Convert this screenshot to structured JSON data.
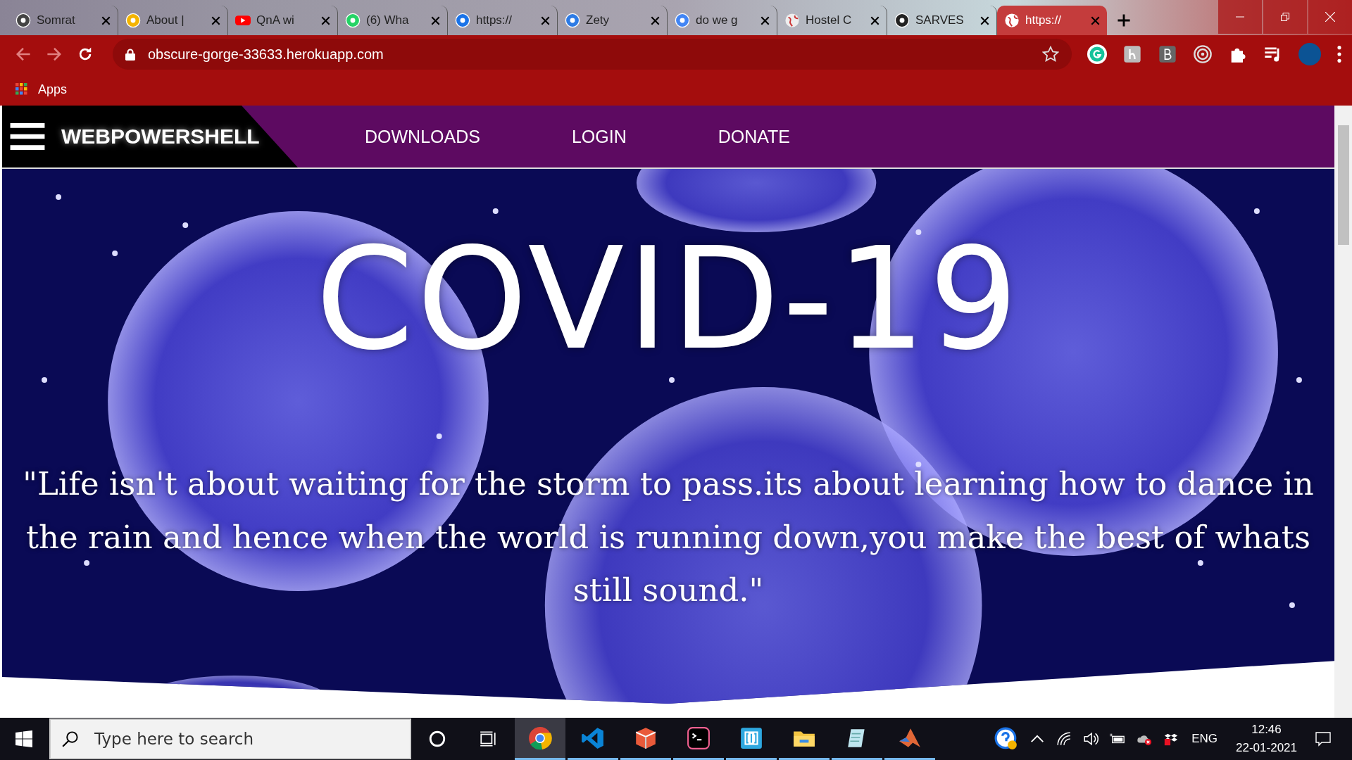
{
  "tabs": [
    {
      "title": "Somrat",
      "selected": false
    },
    {
      "title": "About |",
      "selected": false
    },
    {
      "title": "QnA wi",
      "selected": false
    },
    {
      "title": "(6) Wha",
      "selected": false
    },
    {
      "title": "https://",
      "selected": false
    },
    {
      "title": "Zety",
      "selected": false
    },
    {
      "title": "do we g",
      "selected": false
    },
    {
      "title": "Hostel C",
      "selected": false
    },
    {
      "title": "SARVES",
      "selected": false
    },
    {
      "title": "https://",
      "selected": true
    }
  ],
  "address_bar": {
    "url": "obscure-gorge-33633.herokuapp.com"
  },
  "bookmarks": [
    {
      "label": "Apps"
    }
  ],
  "site": {
    "brand": "WEBPOWERSHELL",
    "nav": [
      {
        "label": "DOWNLOADS"
      },
      {
        "label": "LOGIN"
      },
      {
        "label": "DONATE"
      }
    ],
    "title": "COVID-19",
    "quote": "\"Life isn't about waiting for the storm to pass.its about learning how to dance in the rain and hence when the world is running down,you make the best of whats still sound.\""
  },
  "taskbar": {
    "search": {
      "placeholder": "Type here to search"
    },
    "apps": [
      {
        "kind": "chrome",
        "selected": true
      },
      {
        "kind": "vscode",
        "selected": false
      },
      {
        "kind": "box",
        "selected": false
      },
      {
        "kind": "terminal",
        "selected": false
      },
      {
        "kind": "brackets",
        "selected": false
      },
      {
        "kind": "folder",
        "selected": false
      },
      {
        "kind": "notepad",
        "selected": false
      },
      {
        "kind": "matlab",
        "selected": false
      }
    ],
    "language": "ENG",
    "time": "12:46",
    "date": "22-01-2021"
  }
}
